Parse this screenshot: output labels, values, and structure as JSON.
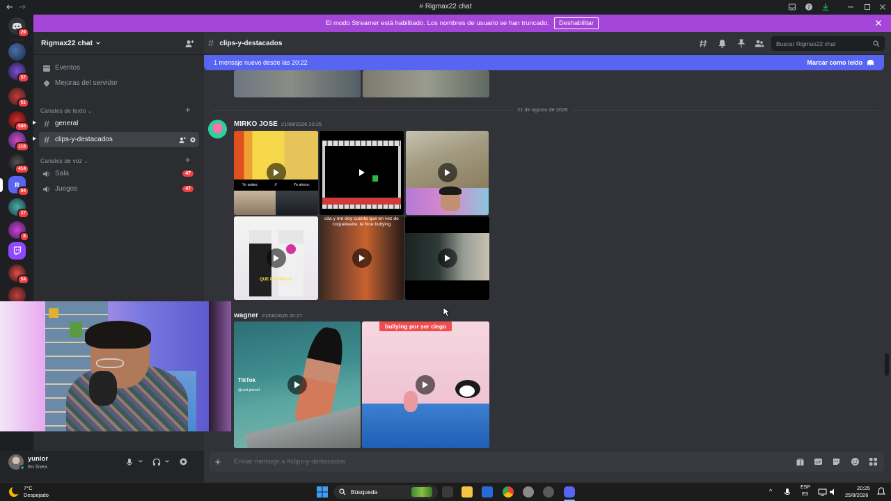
{
  "window": {
    "title": "Rigmax22 chat"
  },
  "banner": {
    "text": "El modo Streamer está habilitado. Los nombres de usuario se han truncado.",
    "button": "Deshabilitar"
  },
  "guild_badges": [
    "29",
    "57",
    "51",
    "580",
    "118",
    "414",
    "94",
    "27",
    "8",
    "54"
  ],
  "server": {
    "name": "Rigmax22 chat"
  },
  "sidebar": {
    "events": "Eventos",
    "boosts": "Mejoras del servidor",
    "text_category": "Canales de texto",
    "text_channels": [
      "general",
      "clips-y-destacados"
    ],
    "voice_category": "Canales de voz",
    "voice_channels": [
      {
        "name": "Sala",
        "count": "47"
      },
      {
        "name": "Juegos",
        "count": "47"
      }
    ]
  },
  "channel": {
    "name": "clips-y-destacados",
    "search_placeholder": "Buscar Rigmax22 chat"
  },
  "new_messages": {
    "text": "1 mensaje nuevo desde las 20:22",
    "action": "Marcar como leído"
  },
  "date_divider": "21 de agosto de 2026",
  "messages": [
    {
      "author": "MIRKO JOSE",
      "timestamp": "21/08/2026 20:25",
      "thumb_texts": [
        "Yo antes:",
        "//",
        "Yo ahora:",
        "cita y me doy cuenta que en vez de coquetearle, le hice bullying",
        "QUE PASARA SI"
      ]
    },
    {
      "author": "wagner",
      "timestamp": "21/08/2026 20:27",
      "thumb_texts": [
        "TikTok",
        "@viral.planet1",
        "bullying por ser ciego"
      ]
    }
  ],
  "user": {
    "name": "yunior",
    "status": "En línea"
  },
  "composer": {
    "placeholder": "Enviar mensaje a #clips-y-destacados"
  },
  "taskbar": {
    "weather_temp": "7°C",
    "weather_desc": "Despejado",
    "search": "Búsqueda",
    "lang1": "ESP",
    "lang2": "ES",
    "time": "20:25",
    "date": "25/8/2026"
  }
}
